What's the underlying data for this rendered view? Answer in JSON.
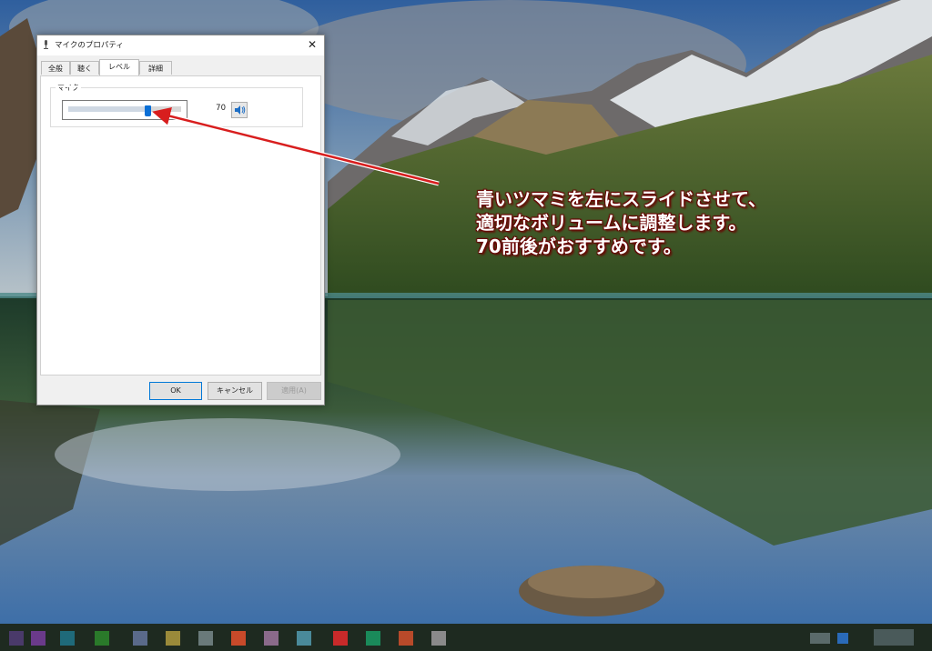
{
  "dialog": {
    "title": "マイクのプロパティ",
    "close_glyph": "✕",
    "tabs": [
      {
        "label": "全般",
        "active": false
      },
      {
        "label": "聴く",
        "active": false
      },
      {
        "label": "レベル",
        "active": true
      },
      {
        "label": "詳細",
        "active": false
      }
    ],
    "level_group": {
      "label": "マイク",
      "value": "70",
      "level_fraction": 0.7
    },
    "buttons": {
      "ok": "OK",
      "cancel": "キャンセル",
      "apply": "適用(A)"
    }
  },
  "annotation": {
    "line1": "青いツマミを左にスライドさせて、",
    "line2": "適切なボリュームに調整します。",
    "line3": "70前後がおすすめです。"
  },
  "colors": {
    "accent": "#0a6fd6",
    "arrow": "#d81e1e",
    "annotation_outline": "#6a0000"
  }
}
